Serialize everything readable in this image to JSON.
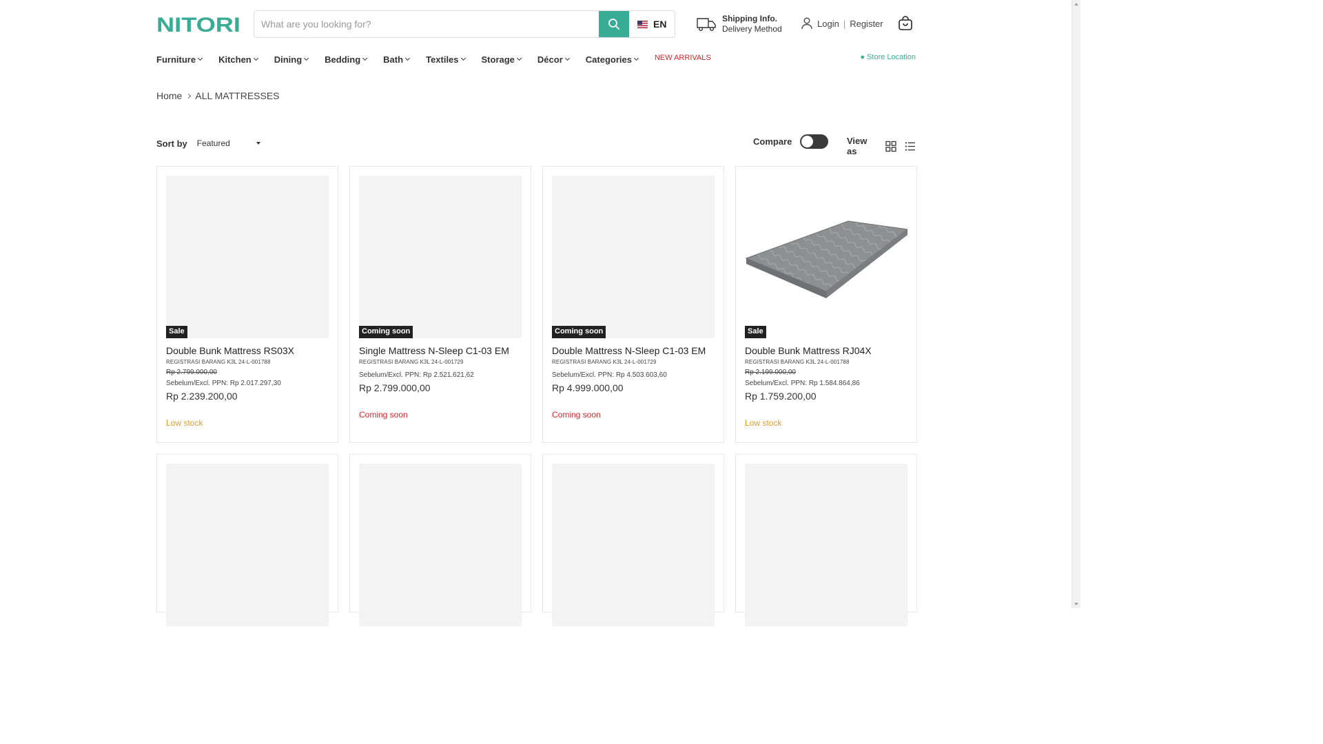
{
  "brand": {
    "logo_text": "NITORI",
    "color": "#39ac95"
  },
  "search": {
    "placeholder": "What are you looking for?",
    "value": ""
  },
  "language": {
    "code": "EN"
  },
  "shipping": {
    "title": "Shipping Info.",
    "subtitle": "Delivery Method"
  },
  "account": {
    "login": "Login",
    "separator": "|",
    "register": "Register"
  },
  "nav": {
    "items": [
      "Furniture",
      "Kitchen",
      "Dining",
      "Bedding",
      "Bath",
      "Textiles",
      "Storage",
      "Décor",
      "Categories"
    ],
    "new_arrivals": "NEW ARRIVALS",
    "store_location": "● Store Location"
  },
  "breadcrumb": {
    "home": "Home",
    "current": "ALL MATTRESSES"
  },
  "toolbar": {
    "sort_label": "Sort by",
    "sort_value": "Featured",
    "compare_label": "Compare",
    "compare_enabled": false,
    "view_label": "View as"
  },
  "products": [
    {
      "badge": "Sale",
      "title": "Double Bunk Mattress RS03X",
      "reg": "REGISTRASI BARANG K3L 24-L-001788",
      "compare_price": "Rp 2.799.000,00",
      "excl": "Sebelum/Excl. PPN: Rp 2.017.297,30",
      "price": "Rp 2.239.200,00",
      "stock": "Low stock",
      "stock_type": "low",
      "has_image": false
    },
    {
      "badge": "Coming soon",
      "title": "Single Mattress N-Sleep C1-03 EM",
      "reg": "REGISTRASI BARANG K3L 24-L-001729",
      "compare_price": "",
      "excl": "Sebelum/Excl. PPN: Rp 2.521.621,62",
      "price": "Rp 2.799.000,00",
      "stock": "Coming soon",
      "stock_type": "soon",
      "has_image": false
    },
    {
      "badge": "Coming soon",
      "title": "Double Mattress N-Sleep C1-03 EM",
      "reg": "REGISTRASI BARANG K3L 24-L-001729",
      "compare_price": "",
      "excl": "Sebelum/Excl. PPN: Rp 4.503.603,60",
      "price": "Rp 4.999.000,00",
      "stock": "Coming soon",
      "stock_type": "soon",
      "has_image": false
    },
    {
      "badge": "Sale",
      "title": "Double Bunk Mattress RJ04X",
      "reg": "REGISTRASI BARANG K3L 24-L-001788",
      "compare_price": "Rp 2.199.000,00",
      "excl": "Sebelum/Excl. PPN: Rp 1.584.864,86",
      "price": "Rp 1.759.200,00",
      "stock": "Low stock",
      "stock_type": "low",
      "has_image": true
    }
  ]
}
